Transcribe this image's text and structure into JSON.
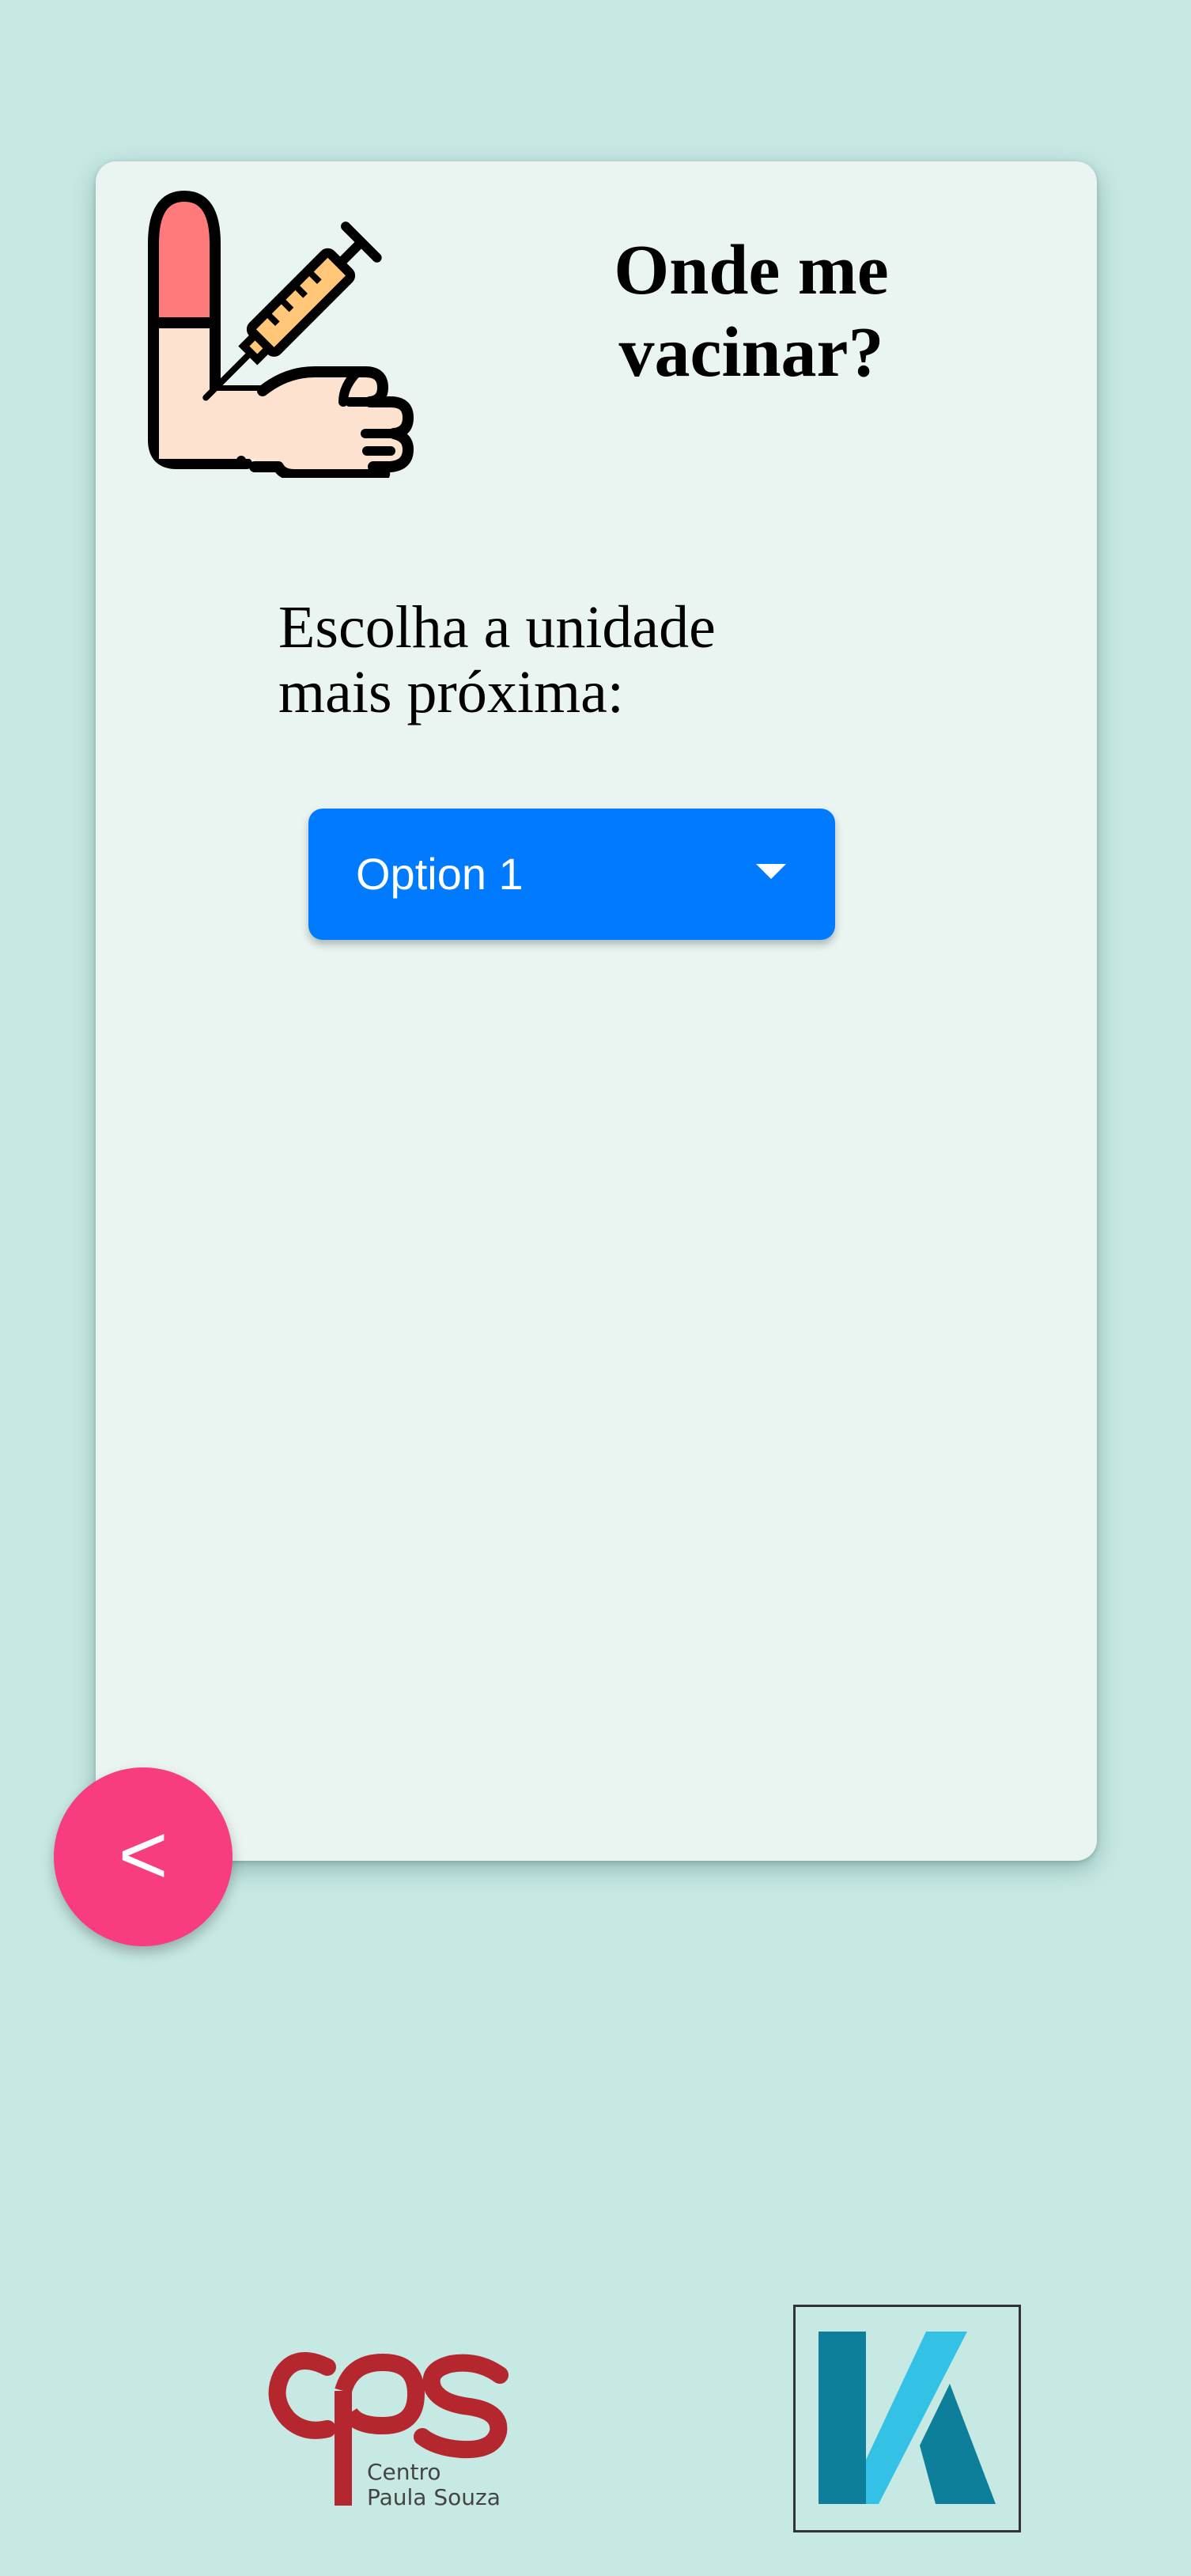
{
  "page": {
    "title_line1": "Onde me",
    "title_line2": "vacinar?",
    "prompt_line1": "Escolha a unidade",
    "prompt_line2": "mais próxima:"
  },
  "unit_select": {
    "selected_value": "Option 1"
  },
  "back_button": {
    "label": "<"
  },
  "footer": {
    "cps_logo_text_line1": "Centro",
    "cps_logo_text_line2": "Paula Souza"
  },
  "icons": {
    "vaccine": "vaccine-arm-syringe-icon",
    "dropdown": "caret-down-icon"
  },
  "colors": {
    "background": "#c7e9e4",
    "card": "#eaf5f1",
    "select_button": "#007bff",
    "back_button": "#f73d7f",
    "cps_red": "#b5272f",
    "k_dark": "#0e7f9a",
    "k_light": "#33c2e6"
  }
}
